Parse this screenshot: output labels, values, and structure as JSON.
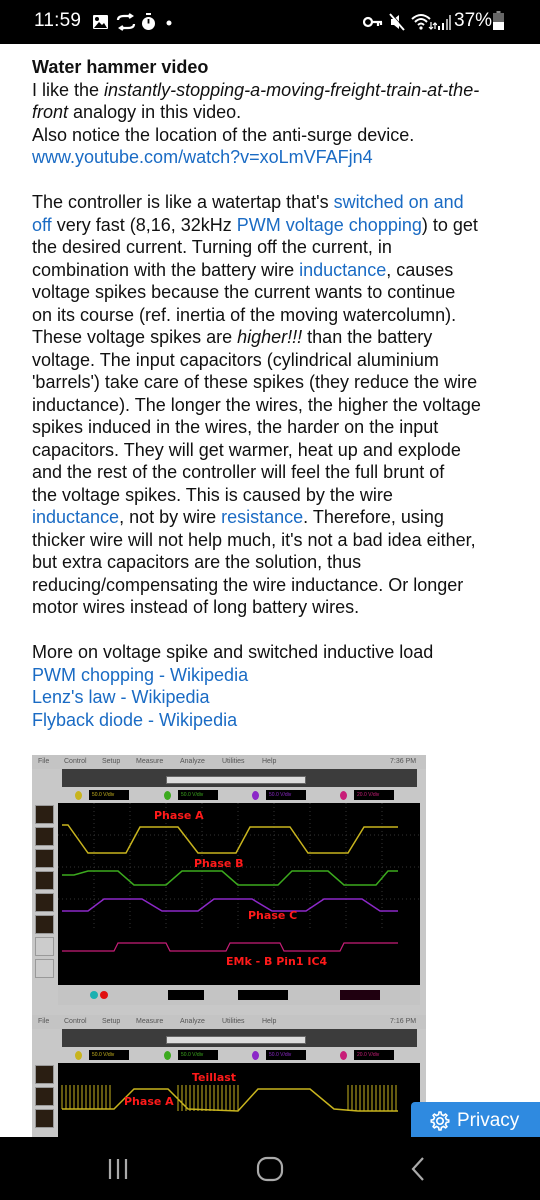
{
  "status_bar": {
    "time": "11:59",
    "left_icons": [
      "gallery-icon",
      "sync-icon",
      "stopwatch-icon",
      "dot-icon"
    ],
    "right_icons": [
      "vpn-key-icon",
      "mute-icon",
      "wifi-icon",
      "signal-icon",
      "battery-icon"
    ],
    "battery_percent": "37%"
  },
  "article": {
    "water_hammer": {
      "title": "Water hammer video",
      "line1_pre": "I like the ",
      "line1_italic": "instantly-stopping-a-moving-freight-train-at-the-",
      "line2_italic": "front",
      "line2_post": " analogy in this video.",
      "line3": "Also notice the location of the anti-surge device.",
      "video_link": "www.youtube.com/watch?v=xoLmVFAFjn4"
    },
    "controller": {
      "l1_a": "The controller is like a watertap that's ",
      "l1_link": "switched on and",
      "l2_link": "off",
      "l2_b": " very fast (8,16, 32kHz ",
      "l2_link2": "PWM voltage chopping",
      "l2_c": ") to get",
      "l3": "the desired current. Turning off the current, in",
      "l4_a": "combination with the battery wire ",
      "l4_link": "inductance",
      "l4_b": ", causes",
      "l5": "voltage spikes because the current wants to continue",
      "l6": "on its course (ref. inertia of the moving watercolumn).",
      "l7_a": "These voltage spikes are ",
      "l7_italic": "higher!!!",
      "l7_b": " than the battery",
      "l8": "voltage. The input capacitors (cylindrical aluminium",
      "l9": "'barrels') take care of these spikes (they reduce the wire",
      "l10": "inductance). The longer the wires, the higher the voltage",
      "l11": "spikes induced in the wires, the harder on the input",
      "l12": "capacitors. They will get warmer, heat up and explode",
      "l13": "and the rest of the controller will feel the full brunt of",
      "l14": "the voltage spikes. This is caused by the wire",
      "l15_link": "inductance",
      "l15_a": ", not by wire ",
      "l15_link2": "resistance",
      "l15_b": ". Therefore, using",
      "l16": "thicker wire will not help much, it's not a bad idea either,",
      "l17": "but extra capacitors are the solution, thus",
      "l18": "reducing/compensating the wire inductance. Or longer",
      "l19": "motor wires instead of long battery wires."
    },
    "more": {
      "intro": "More on voltage spike and switched inductive load",
      "links": [
        "PWM chopping - Wikipedia",
        "Lenz's law - Wikipedia",
        "Flyback diode - Wikipedia"
      ]
    }
  },
  "scope_image": {
    "menu": [
      "File",
      "Control",
      "Setup",
      "Measure",
      "Analyze",
      "Utilities",
      "Help"
    ],
    "top_clock": "7:36 PM",
    "bottom_clock": "7:16 PM",
    "top_labels": [
      "Phase A",
      "Phase B",
      "Phase C",
      "EMk - B Pin1 IC4"
    ],
    "bottom_labels": [
      "Teillast",
      "Phase A"
    ],
    "trace_colors": {
      "a": "#c8b41e",
      "b": "#3caa1e",
      "c": "#8c28c8",
      "d": "#c81e78"
    }
  },
  "privacy_button": {
    "label": "Privacy"
  },
  "nav_bar": {
    "buttons": [
      "recent-apps",
      "home",
      "back"
    ]
  }
}
